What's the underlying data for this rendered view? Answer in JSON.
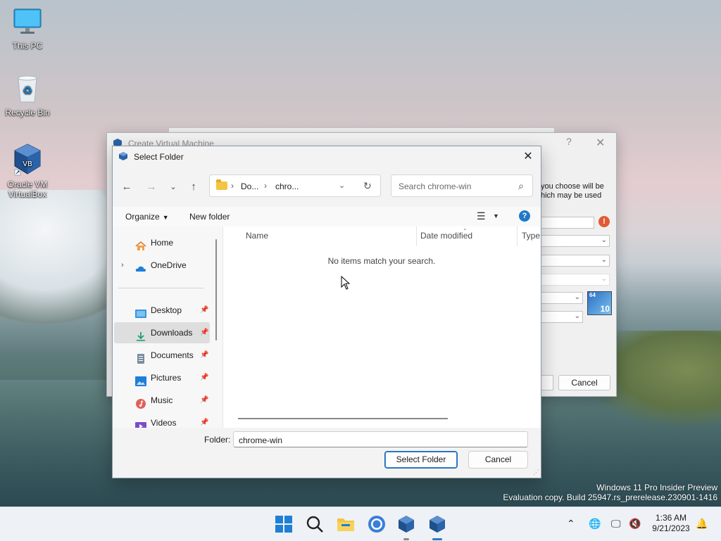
{
  "desktop_icons": [
    {
      "label": "This PC",
      "icon": "monitor-icon"
    },
    {
      "label": "Recycle Bin",
      "icon": "recycle-bin-icon"
    },
    {
      "label": "Oracle VM VirtualBox",
      "icon": "virtualbox-icon"
    }
  ],
  "watermark": {
    "line1": "Windows 11 Pro Insider Preview",
    "line2": "Evaluation copy. Build 25947.rs_prerelease.230901-1416"
  },
  "bg_window": {
    "title": "Create Virtual Machine",
    "help": "?",
    "hint_line1": "you choose will be",
    "hint_line2": "hich may be used",
    "cancel_label": "Cancel",
    "os_badge_bits": "64",
    "os_badge_version": "10"
  },
  "dialog": {
    "title": "Select Folder",
    "address": {
      "seg1": "Do...",
      "seg2": "chro..."
    },
    "search_placeholder": "Search chrome-win",
    "toolbar": {
      "organize": "Organize",
      "new_folder": "New folder"
    },
    "sidebar": [
      {
        "label": "Home",
        "icon": "home-icon"
      },
      {
        "label": "OneDrive",
        "icon": "onedrive-cloud-icon"
      },
      {
        "label": "Desktop",
        "icon": "desktop-folder-icon"
      },
      {
        "label": "Downloads",
        "icon": "download-icon"
      },
      {
        "label": "Documents",
        "icon": "documents-icon"
      },
      {
        "label": "Pictures",
        "icon": "pictures-icon"
      },
      {
        "label": "Music",
        "icon": "music-icon"
      },
      {
        "label": "Videos",
        "icon": "videos-icon"
      }
    ],
    "columns": [
      "Name",
      "Date modified",
      "Type"
    ],
    "empty_message": "No items match your search.",
    "folder_label": "Folder:",
    "folder_value": "chrome-win",
    "select_button": "Select Folder",
    "cancel_button": "Cancel"
  },
  "taskbar": {
    "apps": [
      "start-icon",
      "search-icon",
      "file-explorer-icon",
      "chrome-icon",
      "virtualbox-icon",
      "virtualbox-icon"
    ],
    "time": "1:36 AM",
    "date": "9/21/2023"
  },
  "colors": {
    "accent": "#1f64b3",
    "help_blue": "#1f79c8",
    "warning": "#e25b35",
    "folder_yellow": "#f3c443"
  }
}
